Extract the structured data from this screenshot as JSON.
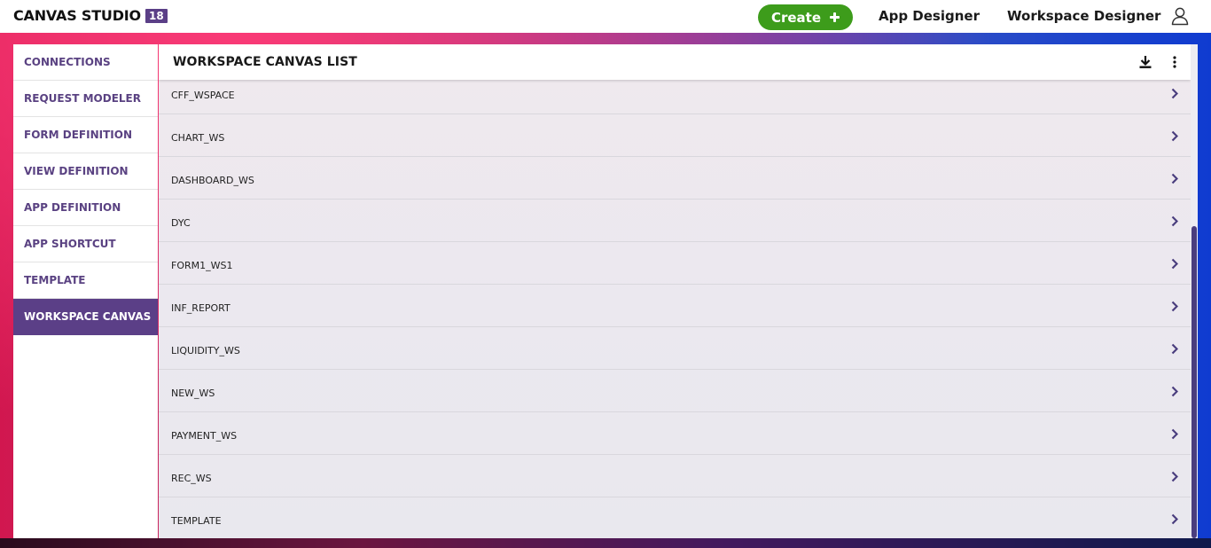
{
  "header": {
    "brand": "CANVAS STUDIO",
    "version_badge": "18",
    "create_label": "Create",
    "nav": [
      "App Designer",
      "Workspace Designer"
    ],
    "user_icon": "user-icon"
  },
  "sidebar": {
    "items": [
      {
        "label": "CONNECTIONS",
        "active": false
      },
      {
        "label": "REQUEST MODELER",
        "active": false
      },
      {
        "label": "FORM DEFINITION",
        "active": false
      },
      {
        "label": "VIEW DEFINITION",
        "active": false
      },
      {
        "label": "APP DEFINITION",
        "active": false
      },
      {
        "label": "APP SHORTCUT",
        "active": false
      },
      {
        "label": "TEMPLATE",
        "active": false
      },
      {
        "label": "WORKSPACE CANVAS",
        "active": true
      }
    ]
  },
  "main": {
    "title": "WORKSPACE CANVAS LIST",
    "actions": [
      "download-icon",
      "more-vertical-icon"
    ],
    "rows": [
      "CFF_WSPACE",
      "CHART_WS",
      "DASHBOARD_WS",
      "DYC",
      "FORM1_WS1",
      "INF_REPORT",
      "LIQUIDITY_WS",
      "NEW_WS",
      "PAYMENT_WS",
      "REC_WS",
      "TEMPLATE"
    ],
    "row_icon": "chevron-right-icon"
  },
  "colors": {
    "accent": "#5b3f87",
    "create": "#3d9c1b",
    "sidebar_text": "#5a4282"
  }
}
